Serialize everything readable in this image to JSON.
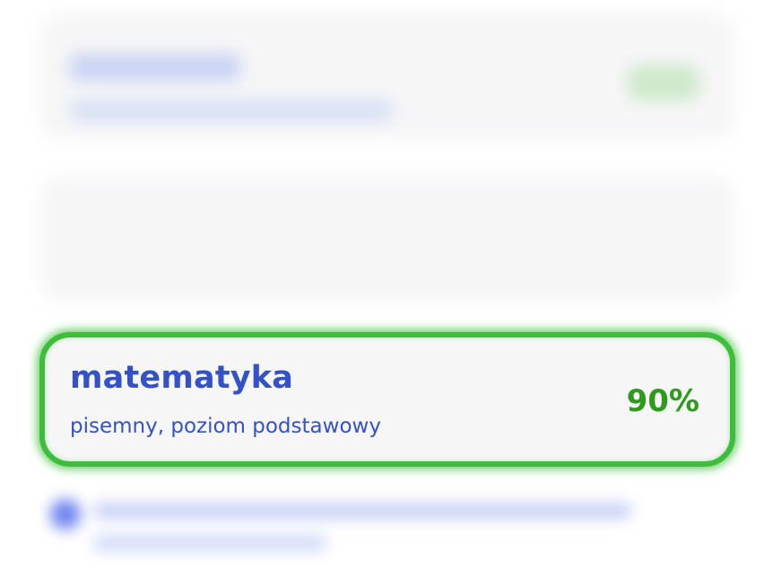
{
  "results": {
    "items": [
      {
        "subject": "",
        "details": "",
        "score": ""
      },
      {
        "subject": "",
        "details": "",
        "score": ""
      },
      {
        "subject": "matematyka",
        "details": "pisemny, poziom podstawowy",
        "score": "90%",
        "highlighted": true
      }
    ]
  },
  "colors": {
    "subject_text": "#3452c7",
    "score_text": "#2e9b1c",
    "highlight_border": "#3cbe3a",
    "card_background": "#f6f6f7"
  },
  "icons": {
    "info": "info-circle-icon"
  }
}
